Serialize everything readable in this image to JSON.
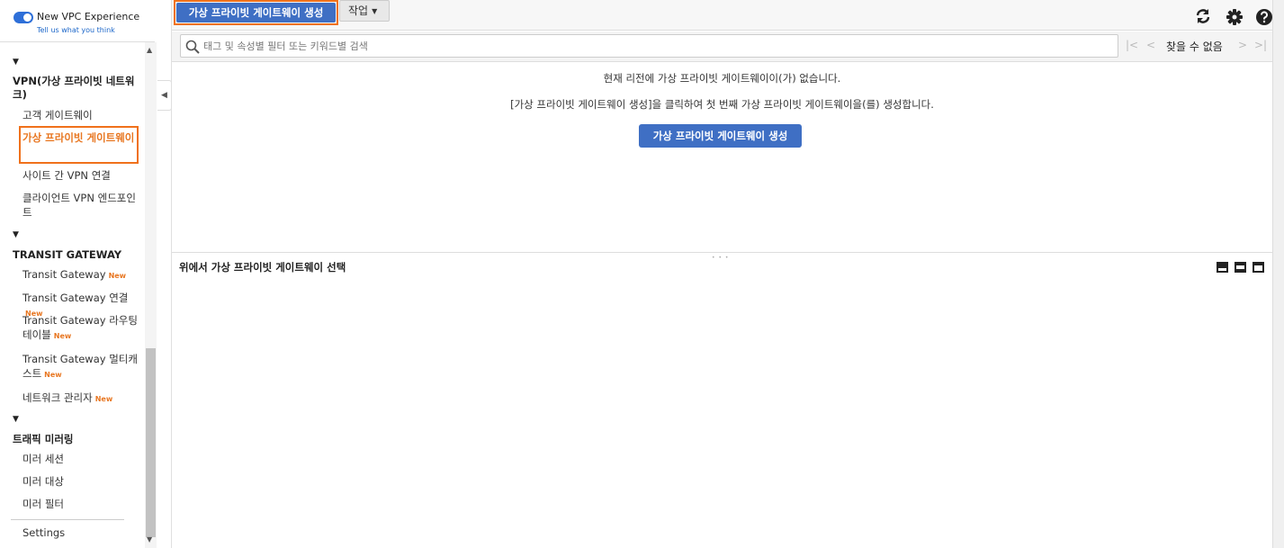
{
  "sidebar": {
    "new_experience_label": "New VPC Experience",
    "feedback_link": "Tell us what you think",
    "vpn_section_title": "VPN(가상 프라이빗 네트워크)",
    "vpn_items": [
      {
        "label": "고객 게이트웨이"
      },
      {
        "label": "가상 프라이빗 게이트웨이",
        "active": true
      },
      {
        "label": "사이트 간 VPN 연결"
      },
      {
        "label": "클라이언트 VPN 엔드포인트"
      }
    ],
    "transit_section_title": "TRANSIT GATEWAY",
    "transit_items": [
      {
        "label": "Transit Gateway",
        "badge": "New"
      },
      {
        "label": "Transit Gateway 연결",
        "badge": "New"
      },
      {
        "label": "Transit Gateway 라우팅 테이블",
        "badge": "New"
      },
      {
        "label": "Transit Gateway 멀티캐스트",
        "badge": "New"
      },
      {
        "label": "네트워크 관리자",
        "badge": "New"
      }
    ],
    "mirroring_section_title": "트래픽 미러링",
    "mirroring_items": [
      {
        "label": "미러 세션"
      },
      {
        "label": "미러 대상"
      },
      {
        "label": "미러 필터"
      }
    ],
    "settings_label": "Settings"
  },
  "toolbar": {
    "create_label": "가상 프라이빗 게이트웨이 생성",
    "actions_label": "작업",
    "icons": [
      "refresh-icon",
      "gear-icon",
      "help-icon"
    ]
  },
  "search": {
    "placeholder": "태그 및 속성별 필터 또는 키워드별 검색",
    "value": ""
  },
  "pager": {
    "result_text": "찾을 수 없음"
  },
  "empty_state": {
    "message": "현재 리전에 가상 프라이빗 게이트웨이이(가) 없습니다.",
    "hint": "[가상 프라이빗 게이트웨이 생성]을 클릭하여 첫 번째 가상 프라이빗 게이트웨이을(를) 생성합니다.",
    "create_label": "가상 프라이빗 게이트웨이 생성"
  },
  "detail_pane": {
    "title": "위에서 가상 프라이빗 게이트웨이 선택"
  },
  "colors": {
    "primary_button": "#3f6fc4",
    "highlight_outline": "#f0711b",
    "active_nav": "#e87722",
    "toggle_on": "#2e6fd8",
    "link": "#1b66c9"
  }
}
